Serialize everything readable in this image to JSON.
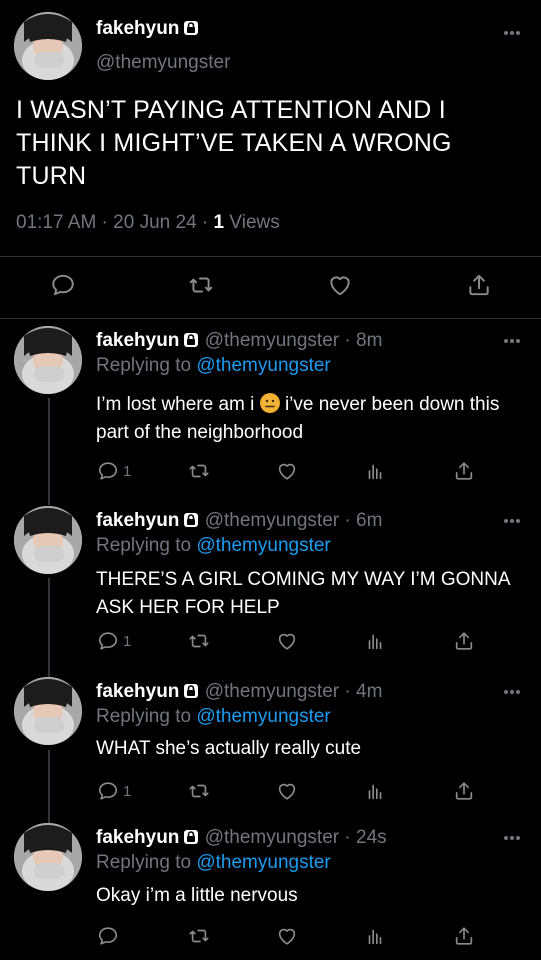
{
  "main_tweet": {
    "name": "fakehyun",
    "handle": "@themyungster",
    "text": "I WASN’T PAYING ATTENTION AND I THINK I MIGHT’VE TAKEN A WRONG TURN",
    "time": "01:17 AM",
    "date": "20 Jun 24",
    "views_count": "1",
    "views_label": "Views"
  },
  "replies": [
    {
      "name": "fakehyun",
      "handle": "@themyungster",
      "age": "8m",
      "replying_prefix": "Replying to",
      "replying_to": "@themyungster",
      "text_a": "I’m lost where am i",
      "text_b": "i’ve never been down this part of the neighborhood",
      "reply_count": "1"
    },
    {
      "name": "fakehyun",
      "handle": "@themyungster",
      "age": "6m",
      "replying_prefix": "Replying to",
      "replying_to": "@themyungster",
      "text": "THERE’S A GIRL COMING MY WAY I’M GONNA ASK HER FOR HELP",
      "reply_count": "1"
    },
    {
      "name": "fakehyun",
      "handle": "@themyungster",
      "age": "4m",
      "replying_prefix": "Replying to",
      "replying_to": "@themyungster",
      "text": "WHAT she’s actually really cute",
      "reply_count": "1"
    },
    {
      "name": "fakehyun",
      "handle": "@themyungster",
      "age": "24s",
      "replying_prefix": "Replying to",
      "replying_to": "@themyungster",
      "text": "Okay i’m a little nervous",
      "reply_count": ""
    }
  ],
  "icons": {
    "reply": "comment-icon",
    "retweet": "retweet-icon",
    "like": "heart-icon",
    "views": "analytics-icon",
    "share": "share-icon",
    "more": "more-icon",
    "lock": "lock-icon"
  },
  "colors": {
    "background": "#000000",
    "text": "#ffffff",
    "muted": "#71767b",
    "link": "#1d9bf0"
  }
}
